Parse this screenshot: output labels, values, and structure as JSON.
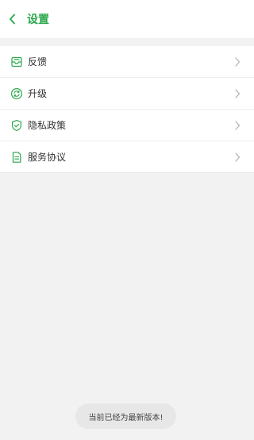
{
  "colors": {
    "accent": "#2aa84a",
    "text": "#333333",
    "chevron": "#b0b0b0",
    "toast_text": "#444444"
  },
  "header": {
    "title": "设置",
    "back_icon": "chevron-left-icon"
  },
  "menu": {
    "items": [
      {
        "label": "反馈",
        "icon": "feedback-inbox-icon"
      },
      {
        "label": "升级",
        "icon": "upgrade-refresh-icon"
      },
      {
        "label": "隐私政策",
        "icon": "privacy-shield-icon"
      },
      {
        "label": "服务协议",
        "icon": "service-document-icon"
      }
    ],
    "chevron_icon": "chevron-right-icon"
  },
  "toast": {
    "message": "当前已经为最新版本!"
  }
}
